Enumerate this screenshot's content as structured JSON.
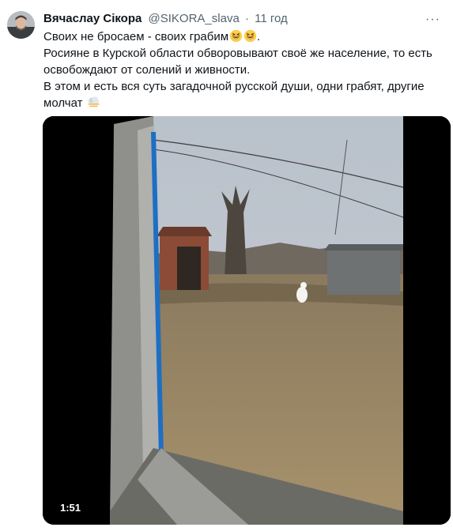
{
  "tweet": {
    "author_name": "Вячаслау Сікора",
    "handle": "@SIKORA_slava",
    "separator": "·",
    "time": "11 год",
    "more_label": "···",
    "line1": "Своих не бросаем - своих грабим",
    "line1_end": ".",
    "line2": "Росияне в Курской области обворовывают своё же население, то есть освобождают от солений и живности.",
    "line3": "В этом и есть вся суть загадочной русской души, одни грабят, другие молчат",
    "emojis": [
      "grinning-squinting-face",
      "grinning-squinting-face",
      "fog"
    ]
  },
  "video": {
    "duration": "1:51"
  }
}
